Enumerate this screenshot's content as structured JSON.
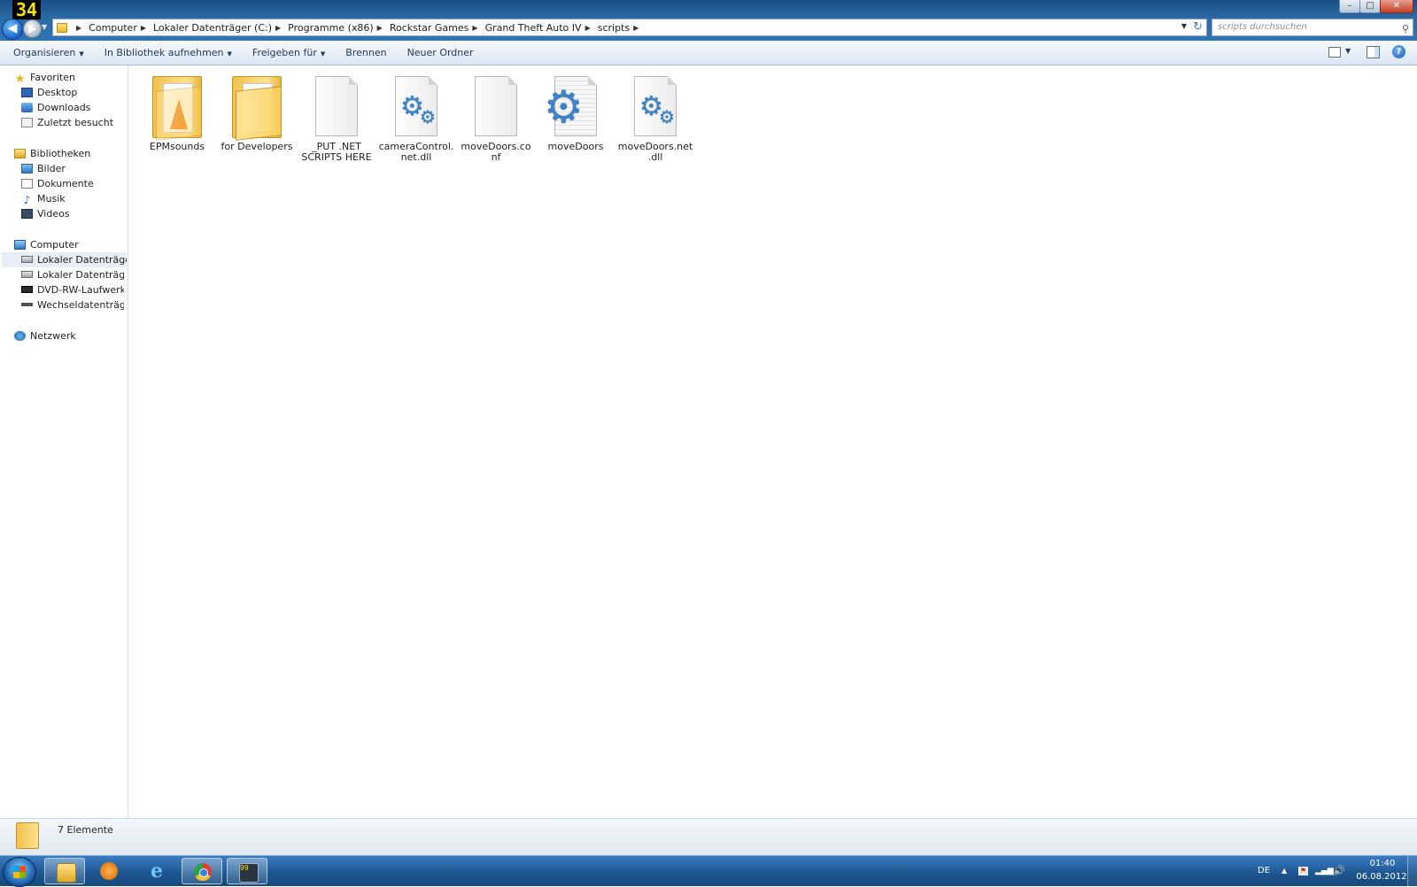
{
  "overlay": {
    "fps": "34"
  },
  "window": {
    "minimize": "–",
    "maximize": "□",
    "close": "✕"
  },
  "nav": {
    "back": "◀",
    "forward": "▶",
    "recent": "▼"
  },
  "address": {
    "crumbs": [
      "Computer",
      "Lokaler Datenträger (C:)",
      "Programme (x86)",
      "Rockstar Games",
      "Grand Theft Auto IV",
      "scripts"
    ],
    "separator": "▶",
    "dropdown": "▼",
    "refresh": "↻"
  },
  "search": {
    "placeholder": "scripts durchsuchen",
    "icon": "⚲"
  },
  "toolbar": {
    "organize": "Organisieren",
    "library": "In Bibliothek aufnehmen",
    "share": "Freigeben für",
    "burn": "Brennen",
    "new_folder": "Neuer Ordner",
    "caret": "▼",
    "help": "?"
  },
  "sidebar": {
    "favorites": "Favoriten",
    "desktop": "Desktop",
    "downloads": "Downloads",
    "recent": "Zuletzt besucht",
    "libraries": "Bibliotheken",
    "pictures": "Bilder",
    "documents": "Dokumente",
    "music": "Musik",
    "videos": "Videos",
    "computer": "Computer",
    "drive_c": "Lokaler Datenträger (C:",
    "drive_d": "Lokaler Datenträger (D:",
    "drive_e": "DVD-RW-Laufwerk (E:)",
    "drive_g": "Wechseldatenträger (G",
    "network": "Netzwerk",
    "star_glyph": "★",
    "note_glyph": "♪"
  },
  "files": [
    {
      "name": "EPMsounds",
      "type": "folder",
      "icon": "vlc-folder-icon"
    },
    {
      "name": "for Developers",
      "type": "folder",
      "icon": "folder-icon"
    },
    {
      "name": "_PUT .NET SCRIPTS HERE",
      "type": "file",
      "icon": "blank-file-icon"
    },
    {
      "name": "cameraControl.net.dll",
      "type": "file",
      "icon": "dll-file-icon"
    },
    {
      "name": "moveDoors.conf",
      "type": "file",
      "icon": "blank-file-icon"
    },
    {
      "name": "moveDoors",
      "type": "file",
      "icon": "config-settings-icon"
    },
    {
      "name": "moveDoors.net.dll",
      "type": "file",
      "icon": "dll-file-icon"
    }
  ],
  "gear_glyph": "⚙",
  "status": {
    "count": "7 Elemente"
  },
  "taskbar": {
    "ie_glyph": "e",
    "game_glyph": "99",
    "lang": "DE",
    "tray_arrow": "▲",
    "tray_flag": "⚑",
    "tray_signal": "▂▄▆",
    "tray_volume": "🔊",
    "time": "01:40",
    "date": "06.08.2012"
  },
  "colors": {
    "taskbar": "#1c558f",
    "titlebar": "#2a6aa6",
    "fps_text": "#f6e500"
  }
}
